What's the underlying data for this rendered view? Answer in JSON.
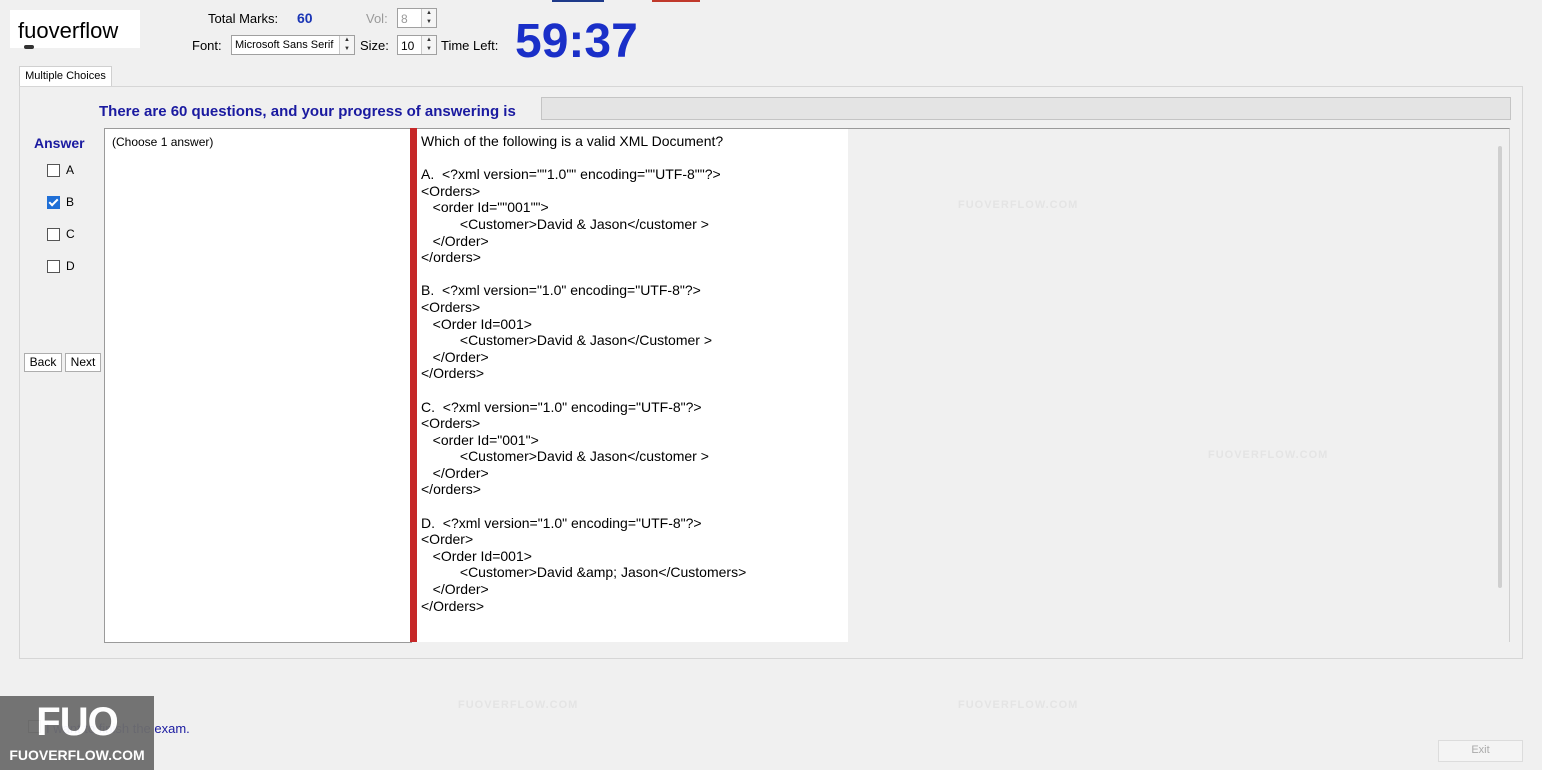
{
  "brand": {
    "name": "fuoverflow"
  },
  "header": {
    "total_marks_label": "Total Marks:",
    "total_marks_value": "60",
    "vol_label": "Vol:",
    "vol_value": "8",
    "font_label": "Font:",
    "font_value": "Microsoft Sans Serif",
    "size_label": "Size:",
    "size_value": "10",
    "time_left_label": "Time Left:",
    "time_left_value": "59:37"
  },
  "tabs": [
    {
      "label": "Multiple Choices"
    }
  ],
  "progress": {
    "label": "There are 60 questions, and your progress of answering is"
  },
  "answer": {
    "heading": "Answer",
    "options": [
      {
        "label": "A",
        "checked": false
      },
      {
        "label": "B",
        "checked": true
      },
      {
        "label": "C",
        "checked": false
      },
      {
        "label": "D",
        "checked": false
      }
    ],
    "hint": "(Choose 1 answer)"
  },
  "nav": {
    "back_label": "Back",
    "next_label": "Next"
  },
  "question": {
    "text": "Which of the following is a valid XML Document?\n\nA.  <?xml version=\"\"1.0\"\" encoding=\"\"UTF-8\"\"?>\n<Orders>\n   <order Id=\"\"001\"\">\n          <Customer>David & Jason</customer >\n   </Order>\n</orders>\n\nB.  <?xml version=\"1.0\" encoding=\"UTF-8\"?>\n<Orders>\n   <Order Id=001>\n          <Customer>David & Jason</Customer >\n   </Order>\n</Orders>\n\nC.  <?xml version=\"1.0\" encoding=\"UTF-8\"?>\n<Orders>\n   <order Id=\"001\">\n          <Customer>David & Jason</customer >\n   </Order>\n</orders>\n\nD.  <?xml version=\"1.0\" encoding=\"UTF-8\"?>\n<Order>\n   <Order Id=001>\n          <Customer>David &amp; Jason</Customers>\n   </Order>\n</Orders>"
  },
  "footer": {
    "finish_label": "I want to finish the exam.",
    "exit_label": "Exit"
  },
  "watermark": {
    "text": "FUOVERFLOW.COM"
  },
  "logo": {
    "big": "FUO",
    "small": "FUOVERFLOW.COM"
  },
  "colors": {
    "accent_blue": "#1a2fc8",
    "label_navy": "#1a1aa0",
    "divider_red": "#c62828"
  }
}
